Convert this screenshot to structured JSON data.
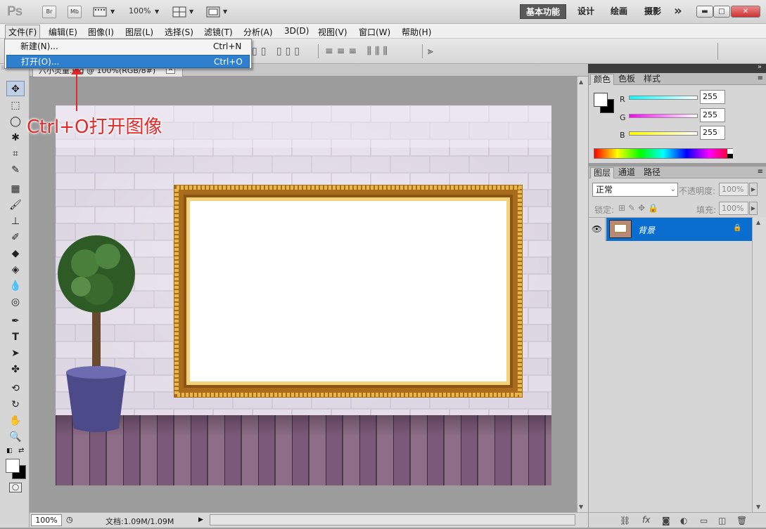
{
  "app": {
    "logo": "Ps",
    "bridge_label": "Br",
    "minibridge_label": "Mb",
    "zoom": "100%",
    "workspaces": [
      "基本功能",
      "设计",
      "绘画",
      "摄影"
    ],
    "more_glyph": "»"
  },
  "menubar": {
    "items": [
      "文件(F)",
      "编辑(E)",
      "图像(I)",
      "图层(L)",
      "选择(S)",
      "滤镜(T)",
      "分析(A)",
      "3D(D)",
      "视图(V)",
      "窗口(W)",
      "帮助(H)"
    ]
  },
  "file_menu": {
    "items": [
      {
        "label": "新建(N)...",
        "shortcut": "Ctrl+N",
        "highlighted": false
      },
      {
        "label": "打开(O)...",
        "shortcut": "Ctrl+O",
        "highlighted": true
      }
    ]
  },
  "document": {
    "tab_title": "六小灵童.jpg @ 100%(RGB/8#)",
    "zoom": "100%",
    "doc_info": "文档:1.09M/1.09M"
  },
  "annotation": {
    "text": "Ctrl+O打开图像",
    "color": "#e32a2a"
  },
  "color_panel": {
    "tabs": [
      "颜色",
      "色板",
      "样式"
    ],
    "channels": [
      {
        "name": "R",
        "value": "255"
      },
      {
        "name": "G",
        "value": "255"
      },
      {
        "name": "B",
        "value": "255"
      }
    ]
  },
  "layers_panel": {
    "tabs": [
      "图层",
      "通道",
      "路径"
    ],
    "blend_mode": "正常",
    "opacity_label": "不透明度:",
    "opacity_value": "100%",
    "lock_label": "锁定:",
    "fill_label": "填充:",
    "fill_value": "100%",
    "layers": [
      {
        "name": "背景",
        "visible": true,
        "locked": true,
        "selected": true
      }
    ]
  },
  "colors": {
    "selection_blue": "#0a6ed1",
    "menu_highlight": "#2f7fcf"
  }
}
